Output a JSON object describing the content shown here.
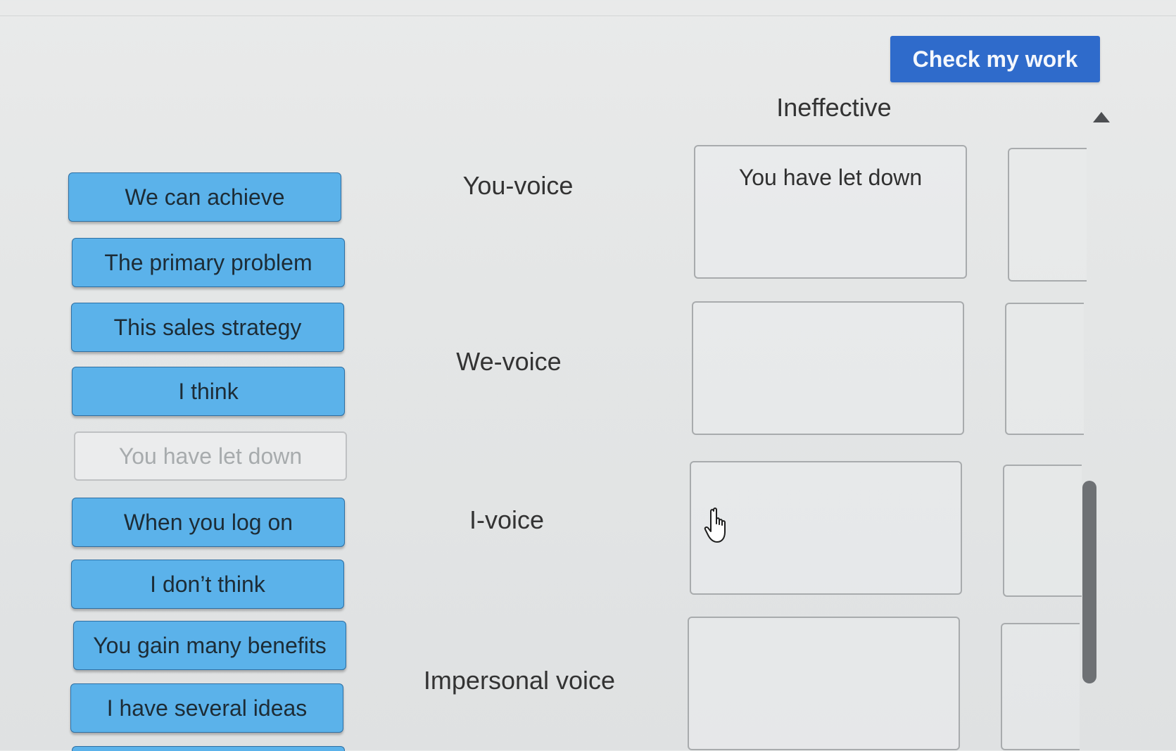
{
  "header": {
    "check_button_label": "Check my work",
    "column_header": "Ineffective"
  },
  "chips": [
    {
      "label": "We can achieve",
      "state": "available"
    },
    {
      "label": "The primary problem",
      "state": "available"
    },
    {
      "label": "This sales strategy",
      "state": "available"
    },
    {
      "label": "I think",
      "state": "available"
    },
    {
      "label": "You have let down",
      "state": "placed"
    },
    {
      "label": "When you log on",
      "state": "available"
    },
    {
      "label": "I don’t think",
      "state": "available"
    },
    {
      "label": "You gain many benefits",
      "state": "available"
    },
    {
      "label": "I have several ideas",
      "state": "available"
    }
  ],
  "rows": [
    {
      "label": "You-voice",
      "ineffective_value": "You have let down"
    },
    {
      "label": "We-voice",
      "ineffective_value": ""
    },
    {
      "label": "I-voice",
      "ineffective_value": ""
    },
    {
      "label": "Impersonal voice",
      "ineffective_value": ""
    }
  ],
  "colors": {
    "button_blue": "#2f6bcb",
    "chip_blue": "#5bb2ea",
    "background": "#e6e8e8"
  },
  "icons": {
    "cursor": "hand-pointer-icon",
    "scroll": "scroll-up-arrow-icon"
  }
}
